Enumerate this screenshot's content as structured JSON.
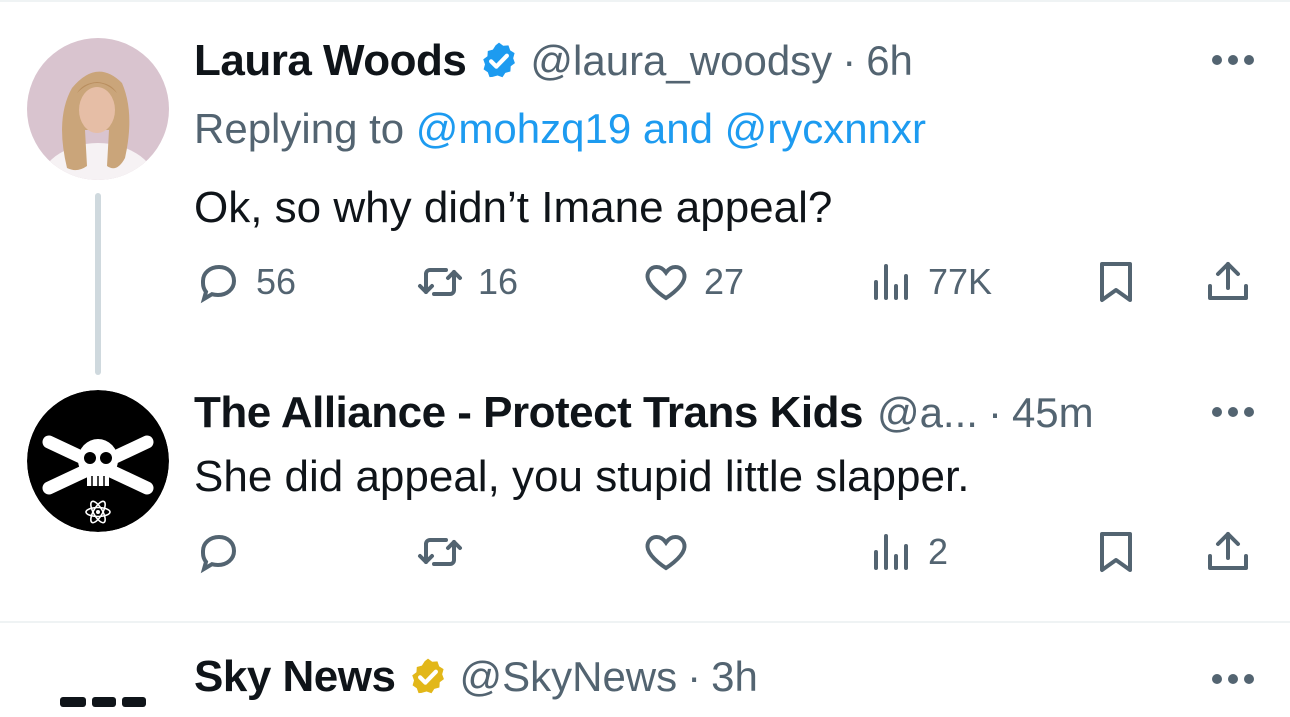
{
  "tweets": [
    {
      "name": "Laura Woods",
      "verified": "blue-check",
      "handle": "@laura_woodsy",
      "dot": "·",
      "time": "6h",
      "replying_prefix": "Replying to ",
      "replying_user1": "@mohzq19",
      "replying_and": " and ",
      "replying_user2": "@rycxnnxr",
      "text": "Ok, so why didn’t Imane appeal?",
      "replies": "56",
      "reposts": "16",
      "likes": "27",
      "views": "77K"
    },
    {
      "name": "The Alliance - Protect Trans Kids",
      "handle": "@a...",
      "dot": "·",
      "time": "45m",
      "text": "She did appeal, you stupid little slapper.",
      "replies": "",
      "reposts": "",
      "likes": "",
      "views": "2"
    },
    {
      "name": "Sky News",
      "verified": "gold-check",
      "handle": "@SkyNews",
      "dot": "·",
      "time": "3h"
    }
  ],
  "colors": {
    "text": "#0f1419",
    "secondary": "#536471",
    "link": "#1d9bf0",
    "verified_blue": "#1d9bf0",
    "verified_gold": "#e2b719",
    "divider": "#eff3f4"
  }
}
